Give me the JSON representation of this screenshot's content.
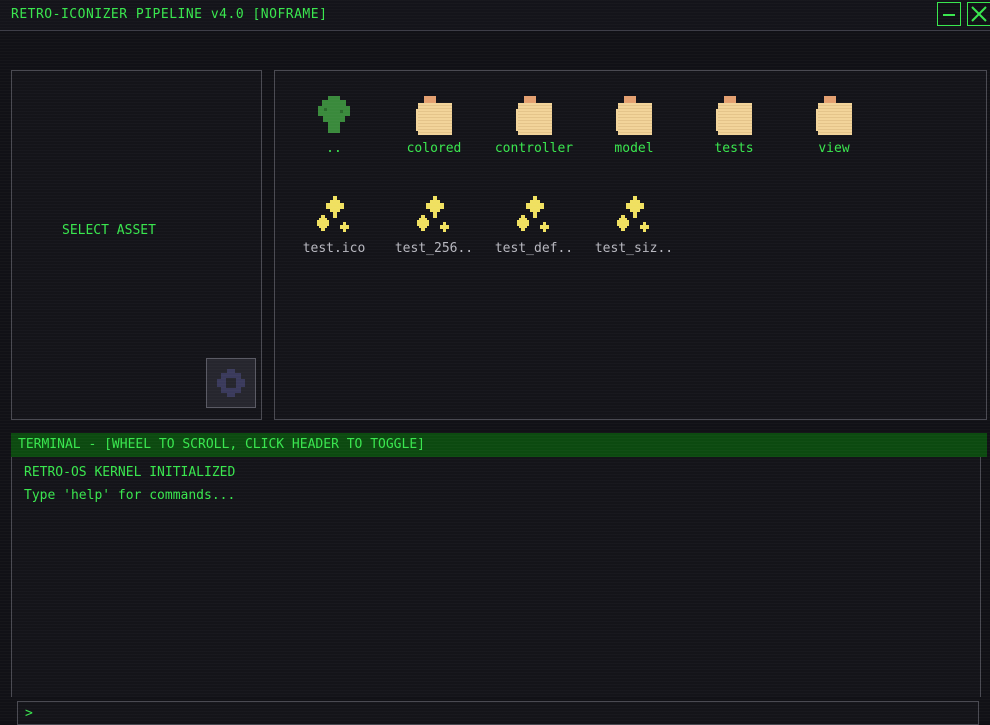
{
  "window": {
    "title": "RETRO-ICONIZER PIPELINE v4.0 [NOFRAME]",
    "minimize_icon": "minimize-icon",
    "close_icon": "close-icon"
  },
  "left_panel": {
    "select_label": "SELECT ASSET",
    "settings_icon": "gear-icon"
  },
  "browser": {
    "items": [
      {
        "label": "..",
        "kind": "parent-folder",
        "icon": "tree-icon",
        "color": "#3a8a3c"
      },
      {
        "label": "colored",
        "kind": "folder",
        "icon": "folder-icon",
        "color": "#f2d49a"
      },
      {
        "label": "controller",
        "kind": "folder",
        "icon": "folder-icon",
        "color": "#f2d49a"
      },
      {
        "label": "model",
        "kind": "folder",
        "icon": "folder-icon",
        "color": "#f2d49a"
      },
      {
        "label": "tests",
        "kind": "folder",
        "icon": "folder-icon",
        "color": "#f2d49a"
      },
      {
        "label": "view",
        "kind": "folder",
        "icon": "folder-icon",
        "color": "#f2d49a"
      },
      {
        "label": "test.ico",
        "kind": "file",
        "icon": "sparkle-icon",
        "color": "#f0e060"
      },
      {
        "label": "test_256..",
        "kind": "file",
        "icon": "sparkle-icon",
        "color": "#f0e060"
      },
      {
        "label": "test_def..",
        "kind": "file",
        "icon": "sparkle-icon",
        "color": "#f0e060"
      },
      {
        "label": "test_siz..",
        "kind": "file",
        "icon": "sparkle-icon",
        "color": "#f0e060"
      }
    ]
  },
  "terminal": {
    "header": "TERMINAL - [WHEEL TO SCROLL, CLICK HEADER TO TOGGLE]",
    "lines": [
      "RETRO-OS KERNEL INITIALIZED",
      "Type 'help' for commands..."
    ],
    "prompt": ">",
    "input_value": ""
  },
  "colors": {
    "accent": "#39e64e",
    "background": "#111116",
    "terminal_header": "#0c4a10",
    "folder": "#f2d49a",
    "folder_tab": "#e4a070",
    "file_sparkle": "#f0e060",
    "parent_tree": "#3a8a3c"
  }
}
